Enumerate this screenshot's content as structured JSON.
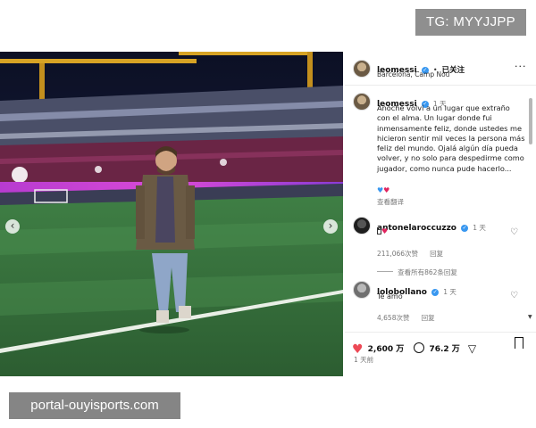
{
  "watermarks": {
    "top": "TG: MYYJJPP",
    "bottom": "portal-ouyisports.com"
  },
  "photo": {
    "description_icon": "stadium-photo",
    "prev_icon": "‹",
    "next_icon": "›"
  },
  "post": {
    "author": "leomessi",
    "verified_icon": "✓",
    "separator": "•",
    "follow_label": "已关注",
    "location": "Barcelona, Camp Nou",
    "more_icon": "···"
  },
  "caption": {
    "author": "leomessi",
    "time": "1 天",
    "text": "Anoche volví a un lugar que extraño con el alma. Un lugar donde fui inmensamente feliz, donde ustedes me hicieron sentir mil veces la persona más feliz del mundo. Ojalá algún día pueda volver, y no solo para despedirme como jugador, como nunca pude hacerlo...",
    "emoji": "♥ ♥",
    "translate_label": "查看翻译"
  },
  "comments": [
    {
      "user": "antonelaroccuzzo",
      "time": "1 天",
      "text": "♥",
      "likes": "211,066次赞",
      "reply_label": "回复",
      "view_replies": "查看所有862条回复"
    },
    {
      "user": "lolobollano",
      "time": "1 天",
      "text": "Te amo",
      "likes": "4,658次赞",
      "reply_label": "回复"
    }
  ],
  "actions": {
    "likes": "2,600 万",
    "comments": "76.2 万",
    "posted": "1 天前"
  },
  "colors": {
    "accent_blue": "#3897f0",
    "like_red": "#ed4956"
  }
}
